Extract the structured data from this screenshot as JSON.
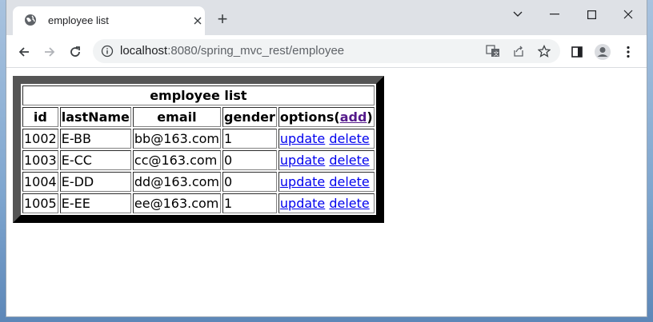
{
  "browser": {
    "tab_title": "employee list",
    "new_tab_label": "+",
    "url_host": "localhost",
    "url_rest": ":8080/spring_mvc_rest/employee"
  },
  "table": {
    "caption": "employee list",
    "headers": {
      "id": "id",
      "lastName": "lastName",
      "email": "email",
      "gender": "gender",
      "options_prefix": "options(",
      "options_add": "add",
      "options_suffix": ")"
    },
    "rows": [
      {
        "id": "1002",
        "lastName": "E-BB",
        "email": "bb@163.com",
        "gender": "1",
        "update": "update",
        "delete": "delete"
      },
      {
        "id": "1003",
        "lastName": "E-CC",
        "email": "cc@163.com",
        "gender": "0",
        "update": "update",
        "delete": "delete"
      },
      {
        "id": "1004",
        "lastName": "E-DD",
        "email": "dd@163.com",
        "gender": "0",
        "update": "update",
        "delete": "delete"
      },
      {
        "id": "1005",
        "lastName": "E-EE",
        "email": "ee@163.com",
        "gender": "1",
        "update": "update",
        "delete": "delete"
      }
    ]
  },
  "colors": {
    "link": "#0000ee",
    "visited_link": "#551a8b",
    "table_border": "#555555",
    "tabbar_bg": "#dee1e6"
  }
}
